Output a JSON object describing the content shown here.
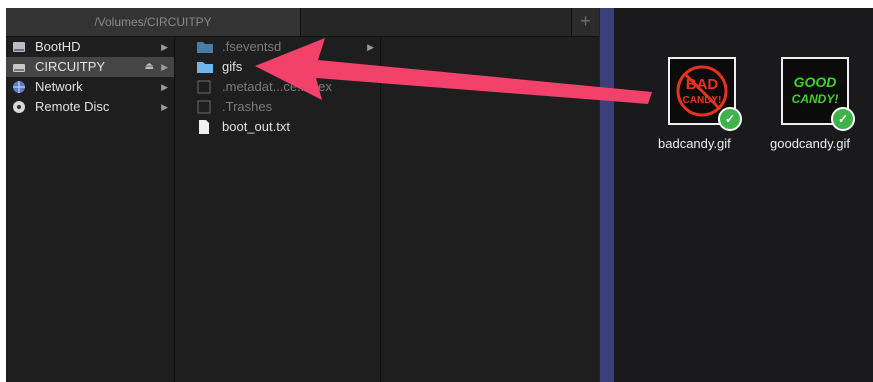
{
  "finder": {
    "path_tab": "/Volumes/CIRCUITPY",
    "add_tab": "+",
    "sidebar": [
      {
        "label": "BootHD",
        "icon": "hard-drive-icon",
        "selected": false,
        "eject": ""
      },
      {
        "label": "CIRCUITPY",
        "icon": "external-drive-icon",
        "selected": true,
        "eject": "⏏"
      },
      {
        "label": "Network",
        "icon": "network-globe-icon",
        "selected": false,
        "eject": ""
      },
      {
        "label": "Remote Disc",
        "icon": "disc-icon",
        "selected": false,
        "eject": ""
      }
    ],
    "files": [
      {
        "label": ".fseventsd",
        "icon": "folder-icon",
        "dim": true,
        "chevron": true
      },
      {
        "label": "gifs",
        "icon": "folder-icon",
        "dim": false,
        "chevron": false
      },
      {
        "label": ".metadat...ce.index",
        "icon": "generic-file-icon",
        "dim": true,
        "chevron": false
      },
      {
        "label": ".Trashes",
        "icon": "generic-file-icon",
        "dim": true,
        "chevron": false
      },
      {
        "label": "boot_out.txt",
        "icon": "text-file-icon",
        "dim": false,
        "chevron": false
      }
    ]
  },
  "desktop": {
    "items": [
      {
        "filename": "badcandy.gif",
        "art_text": "BAD CANDY!",
        "art_color": "#e8321e"
      },
      {
        "filename": "goodcandy.gif",
        "art_text": "GOOD CANDY!",
        "art_color": "#3fd12a"
      }
    ]
  },
  "colors": {
    "arrow": "#f2416b",
    "divider": "#3e3f78",
    "check_badge": "#3db34a"
  }
}
